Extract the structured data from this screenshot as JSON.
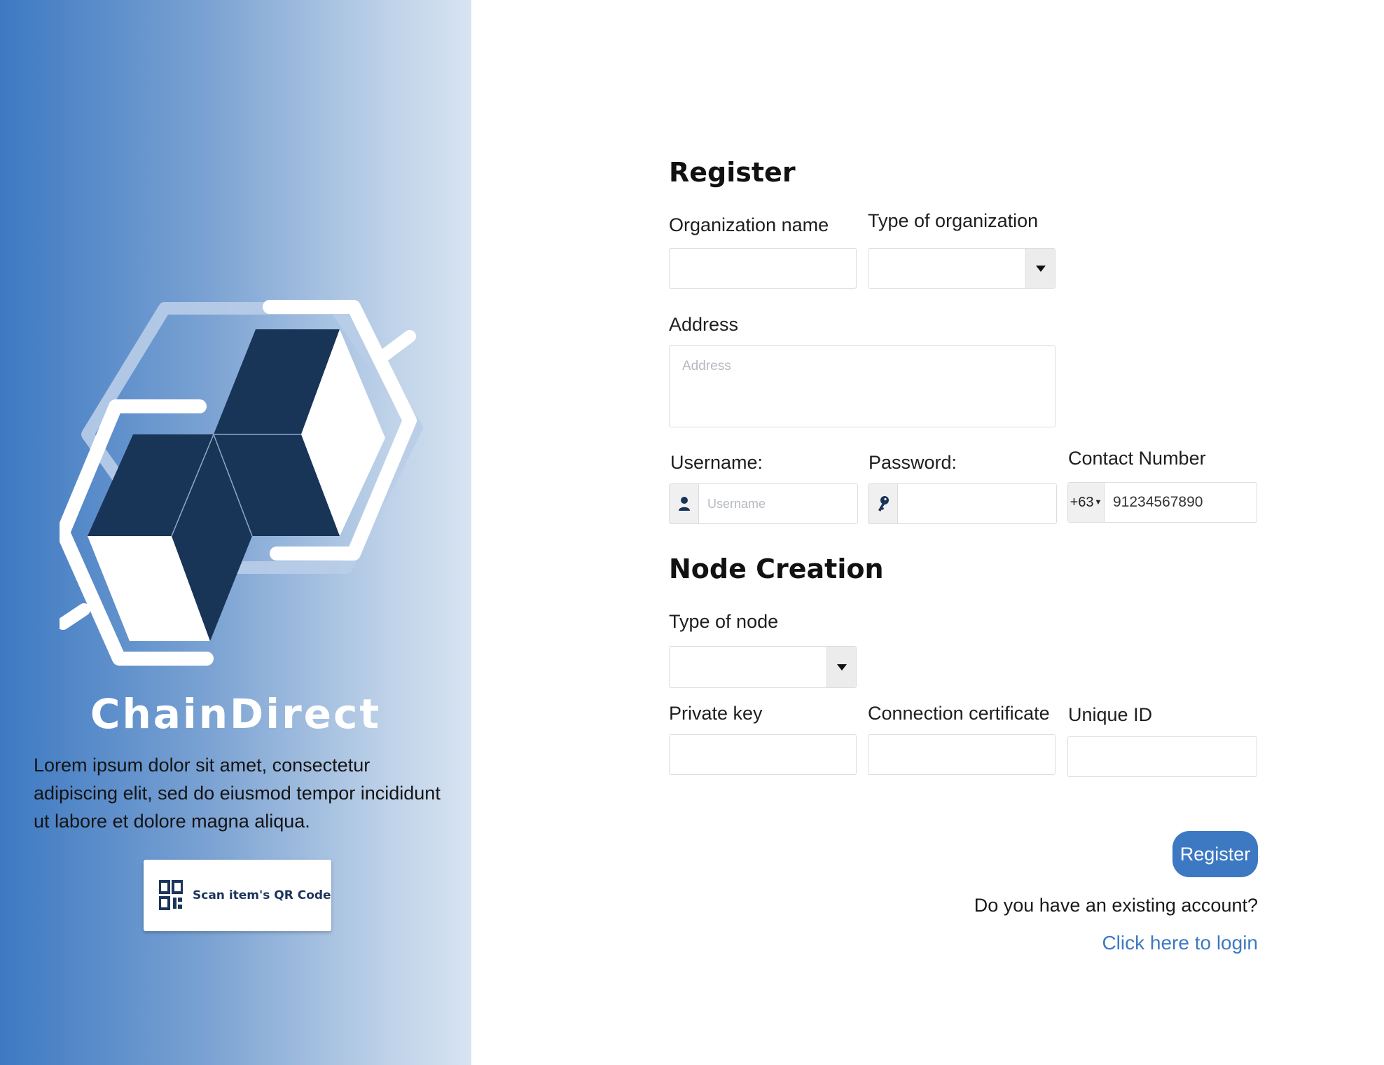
{
  "left_panel": {
    "brand_name": "ChainDirect",
    "description": "Lorem ipsum dolor sit amet, consectetur adipiscing elit, sed do eiusmod tempor incididunt ut labore et dolore magna aliqua.",
    "qr_button_label": "Scan item's QR Code",
    "gradient_colors": [
      "#3d79c2",
      "#d8e4f2"
    ],
    "logo_colors": {
      "dark": "#183456",
      "light": "#ffffff",
      "accent": "#b9cde8"
    }
  },
  "register": {
    "title": "Register",
    "organization_name_label": "Organization name",
    "organization_name_value": "",
    "type_of_organization_label": "Type of organization",
    "type_of_organization_value": "",
    "address_label": "Address",
    "address_placeholder": "Address",
    "username_label": "Username:",
    "username_placeholder": "Username",
    "username_icon": "user-icon",
    "password_label": "Password:",
    "password_icon": "key-icon",
    "contact_label": "Contact Number",
    "country_code": "+63",
    "contact_value": "91234567890"
  },
  "node_creation": {
    "title": "Node Creation",
    "type_of_node_label": "Type of node",
    "type_of_node_value": "",
    "private_key_label": "Private key",
    "connection_certificate_label": "Connection certificate",
    "unique_id_label": "Unique ID"
  },
  "actions": {
    "register_button": "Register",
    "existing_account_text": "Do you have an existing account?",
    "login_link": "Click here to login"
  },
  "colors": {
    "accent": "#3d79c2",
    "field_border": "#dadde2",
    "addon_bg": "#f0f0f0"
  }
}
